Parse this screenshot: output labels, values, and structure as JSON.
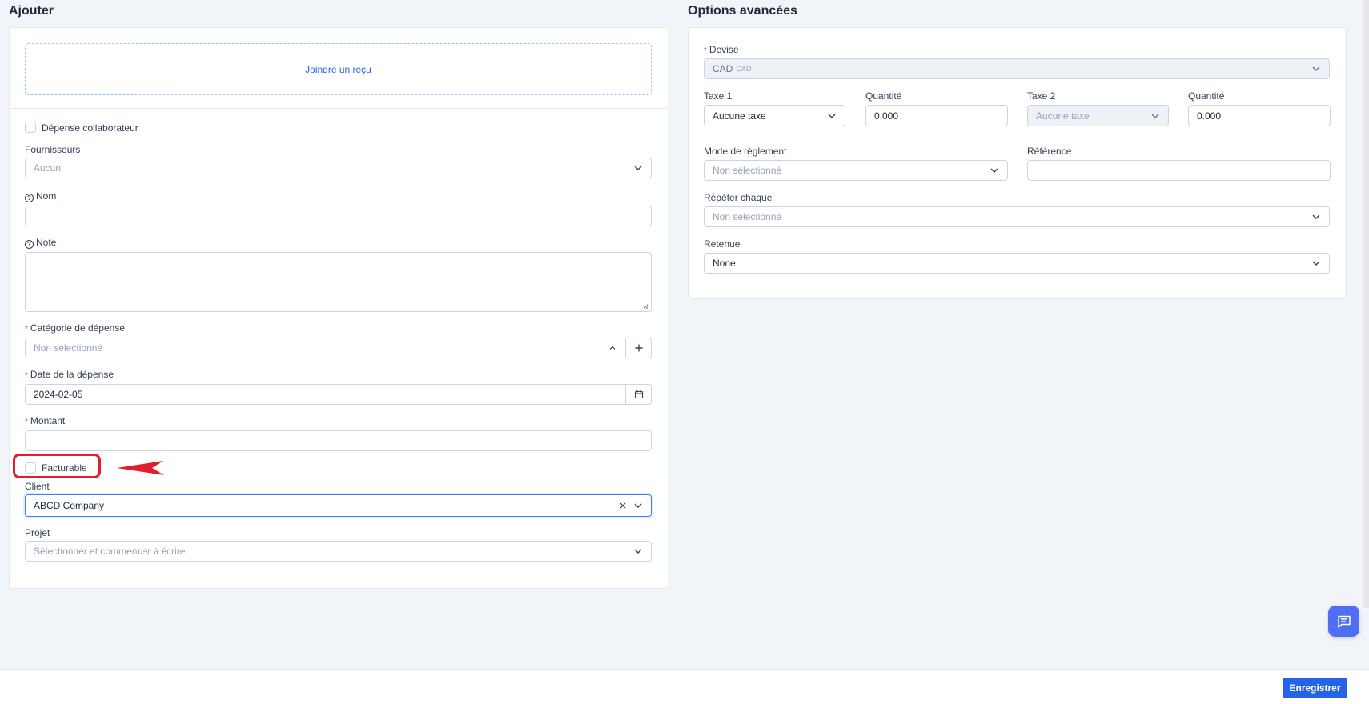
{
  "left": {
    "title": "Ajouter",
    "receipt_link": "Joindre un reçu",
    "employee_expense_label": "Dépense collaborateur",
    "suppliers_label": "Fournisseurs",
    "suppliers_placeholder": "Aucun",
    "name_label": "Nom",
    "note_label": "Note",
    "category_label": "Catégorie de dépense",
    "category_placeholder": "Non sélectionné",
    "date_label": "Date de la dépense",
    "date_value": "2024-02-05",
    "amount_label": "Montant",
    "billable_label": "Facturable",
    "client_label": "Client",
    "client_value": "ABCD Company",
    "project_label": "Projet",
    "project_placeholder": "Sélectionner et commencer à écrire"
  },
  "right": {
    "title": "Options avancées",
    "currency_label": "Devise",
    "currency_value": "CAD",
    "currency_code": "CAD",
    "tax1_label": "Taxe 1",
    "tax1_value": "Aucune taxe",
    "qty1_label": "Quantité",
    "qty1_value": "0.000",
    "tax2_label": "Taxe 2",
    "tax2_value": "Aucune taxe",
    "qty2_label": "Quantité",
    "qty2_value": "0.000",
    "payment_mode_label": "Mode de règlement",
    "payment_mode_placeholder": "Non sélectionné",
    "reference_label": "Référence",
    "repeat_label": "Répéter chaque",
    "repeat_placeholder": "Non sélectionné",
    "retention_label": "Retenue",
    "retention_value": "None"
  },
  "footer": {
    "save_label": "Enregistrer"
  },
  "colors": {
    "accent": "#2563eb",
    "link": "#2563eb",
    "required": "#ef4444",
    "annotation": "#e11d2e",
    "page_background": "#f1f5f9"
  },
  "icons": {
    "chat": "chat-icon",
    "calendar": "calendar-icon",
    "plus": "plus-icon",
    "chevron": "chevron-down-icon",
    "clear": "close-icon"
  }
}
